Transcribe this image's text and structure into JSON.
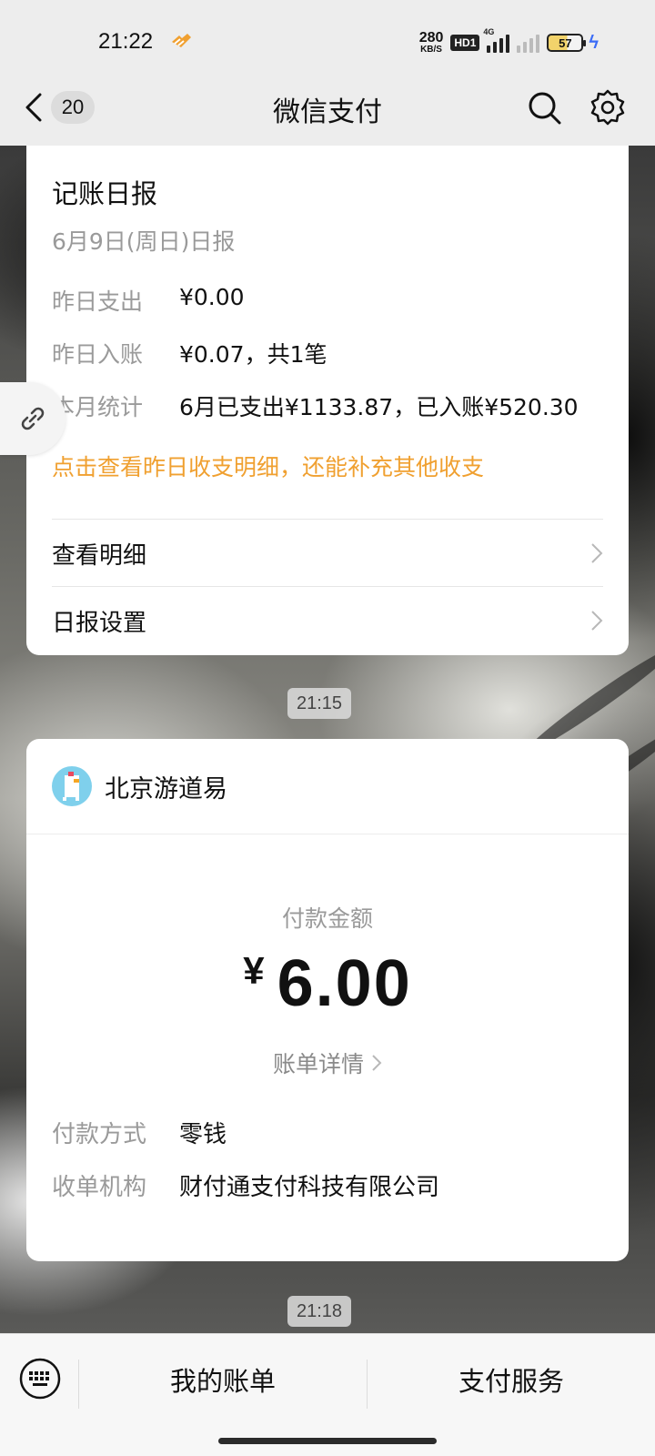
{
  "status_bar": {
    "time": "21:22",
    "net_speed_value": "280",
    "net_speed_unit": "KB/S",
    "hd_label": "HD1",
    "network_type": "4G",
    "battery_level": "57",
    "accent_color": "#f0a030"
  },
  "nav": {
    "unread_count": "20",
    "title": "微信支付",
    "icons": [
      "chevron-left-icon",
      "search-icon",
      "gear-icon"
    ]
  },
  "report_card": {
    "title": "记账日报",
    "date": "6月9日(周日)日报",
    "rows": [
      {
        "label": "昨日支出",
        "value": "¥0.00"
      },
      {
        "label": "昨日入账",
        "value": "¥0.07，共1笔"
      },
      {
        "label": "本月统计",
        "value": "6月已支出¥1133.87，已入账¥520.30"
      }
    ],
    "hint": "点击查看昨日收支明细，还能补充其他收支",
    "links": [
      "查看明细",
      "日报设置"
    ]
  },
  "timestamps": [
    "21:15",
    "21:18"
  ],
  "payment_card": {
    "merchant": "北京游道易",
    "amount_label": "付款金额",
    "currency": "¥",
    "amount": "6.00",
    "bill_detail": "账单详情",
    "rows": [
      {
        "label": "付款方式",
        "value": "零钱"
      },
      {
        "label": "收单机构",
        "value": "财付通支付科技有限公司"
      }
    ]
  },
  "bottom_bar": {
    "menu": [
      "我的账单",
      "支付服务"
    ]
  }
}
